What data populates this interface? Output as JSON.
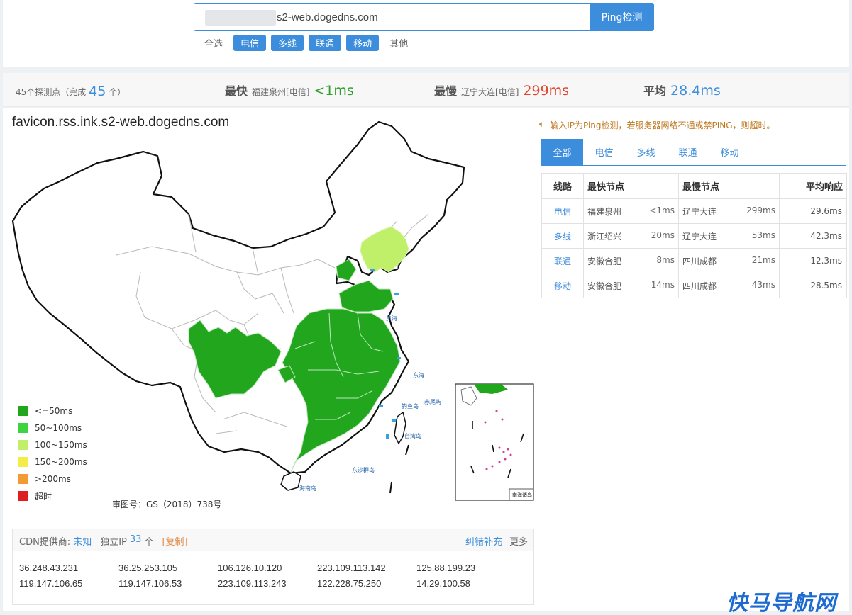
{
  "search": {
    "value": "s2-web.dogedns.com",
    "button": "Ping检测"
  },
  "filters": {
    "all": "全选",
    "chips": [
      "电信",
      "多线",
      "联通",
      "移动"
    ],
    "other": "其他"
  },
  "stats": {
    "count_prefix": "45个探测点（完成",
    "count": "45",
    "count_suffix": "个）",
    "fastest_label": "最快",
    "fastest_loc": "福建泉州[电信]",
    "fastest_val": "<1ms",
    "slowest_label": "最慢",
    "slowest_loc": "辽宁大连[电信]",
    "slowest_val": "299ms",
    "avg_label": "平均",
    "avg_val": "28.4ms",
    "colors": {
      "fast": "#2e9e2e",
      "slow": "#e0442a",
      "avg": "#3c8ddb"
    }
  },
  "map": {
    "title": "favicon.rss.ink.s2-web.dogedns.com",
    "approval": "审图号：GS（2018）738号",
    "legend": [
      {
        "label": "<=50ms",
        "color": "#22a61e"
      },
      {
        "label": "50~100ms",
        "color": "#3fd33f"
      },
      {
        "label": "100~150ms",
        "color": "#c0f06a"
      },
      {
        "label": "150~200ms",
        "color": "#f4ec48"
      },
      {
        "label": ">200ms",
        "color": "#f29a34"
      },
      {
        "label": "超时",
        "color": "#dd1f1f"
      }
    ],
    "sea_labels": [
      "黄海",
      "东海",
      "台湾岛",
      "东沙群岛",
      "海南岛",
      "钓鱼岛",
      "赤尾屿"
    ],
    "inset_label": "南海诸岛"
  },
  "notice": {
    "icon": "speaker-icon",
    "text": "输入IP为Ping检测，若服务器网络不通或禁PING，则超时。"
  },
  "tabs": [
    "全部",
    "电信",
    "多线",
    "联通",
    "移动"
  ],
  "table": {
    "headers": [
      "线路",
      "最快节点",
      "最慢节点",
      "平均响应"
    ],
    "rows": [
      {
        "line": "电信",
        "fast_node": "福建泉州",
        "fast_ms": "<1ms",
        "slow_node": "辽宁大连",
        "slow_ms": "299ms",
        "avg": "29.6ms"
      },
      {
        "line": "多线",
        "fast_node": "浙江绍兴",
        "fast_ms": "20ms",
        "slow_node": "辽宁大连",
        "slow_ms": "53ms",
        "avg": "42.3ms"
      },
      {
        "line": "联通",
        "fast_node": "安徽合肥",
        "fast_ms": "8ms",
        "slow_node": "四川成都",
        "slow_ms": "21ms",
        "avg": "12.3ms"
      },
      {
        "line": "移动",
        "fast_node": "安徽合肥",
        "fast_ms": "14ms",
        "slow_node": "四川成都",
        "slow_ms": "43ms",
        "avg": "28.5ms"
      }
    ]
  },
  "cdn": {
    "provider_label": "CDN提供商:",
    "provider_value": "未知",
    "ip_label": "独立IP",
    "ip_count": "33",
    "ip_unit": "个",
    "copy": "[复制]",
    "correct": "纠错补充",
    "more": "更多",
    "ips": [
      "36.248.43.231",
      "36.25.253.105",
      "106.126.10.120",
      "223.109.113.142",
      "125.88.199.23",
      "119.147.106.65",
      "119.147.106.53",
      "223.109.113.243",
      "122.228.75.250",
      "14.29.100.58"
    ]
  },
  "watermark": "快马导航网"
}
